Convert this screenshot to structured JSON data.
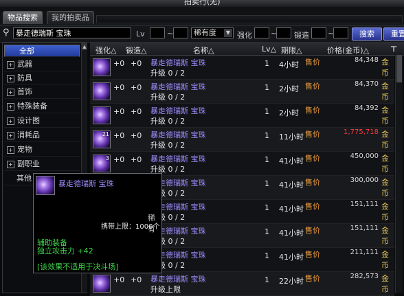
{
  "window": {
    "title": "拍卖行(无)"
  },
  "tabs": [
    {
      "label": "物品搜索",
      "active": true
    },
    {
      "label": "我的拍卖品",
      "active": false
    }
  ],
  "search": {
    "value": "暴走德瑞斯  宝珠",
    "lv_label": "Lv",
    "tilde": "~",
    "rarity_select": "稀有度",
    "enhance_label": "强化",
    "refine_label": "锻造",
    "search_button": "搜索",
    "reset_button": "重置"
  },
  "categories": [
    {
      "label": "全部",
      "selected": true,
      "expandable": false
    },
    {
      "label": "武器",
      "selected": false,
      "expandable": true
    },
    {
      "label": "防具",
      "selected": false,
      "expandable": true
    },
    {
      "label": "首饰",
      "selected": false,
      "expandable": true
    },
    {
      "label": "特殊装备",
      "selected": false,
      "expandable": true
    },
    {
      "label": "设计图",
      "selected": false,
      "expandable": true
    },
    {
      "label": "消耗品",
      "selected": false,
      "expandable": true
    },
    {
      "label": "宠物",
      "selected": false,
      "expandable": true
    },
    {
      "label": "副职业",
      "selected": false,
      "expandable": true
    },
    {
      "label": "其他",
      "selected": false,
      "expandable": false
    }
  ],
  "columns": {
    "enhance": "强化△",
    "refine": "锻造△",
    "name": "名称△",
    "lv": "Lv△",
    "period": "期限△",
    "price": "价格(金币)△"
  },
  "listings": [
    {
      "count": "",
      "enhance": "+0",
      "refine": "+0",
      "name": "暴走德瑞斯  宝珠",
      "upgrade": "升级 0 / 2",
      "lv": "1",
      "time": "4小时",
      "type": "售价",
      "price": "84,348",
      "currency": "金币",
      "red": false
    },
    {
      "count": "",
      "enhance": "+0",
      "refine": "+0",
      "name": "暴走德瑞斯  宝珠",
      "upgrade": "升级 0 / 2",
      "lv": "1",
      "time": "2小时",
      "type": "售价",
      "price": "84,370",
      "currency": "金币",
      "red": false
    },
    {
      "count": "",
      "enhance": "+0",
      "refine": "+0",
      "name": "暴走德瑞斯  宝珠",
      "upgrade": "升级 0 / 2",
      "lv": "1",
      "time": "2小时",
      "type": "售价",
      "price": "84,392",
      "currency": "金币",
      "red": false
    },
    {
      "count": "21",
      "enhance": "+0",
      "refine": "+0",
      "name": "暴走德瑞斯  宝珠",
      "upgrade": "升级 0 / 2",
      "lv": "1",
      "time": "11小时",
      "type": "售价",
      "price": "1,775,718",
      "currency": "金币",
      "red": true
    },
    {
      "count": "3",
      "enhance": "+0",
      "refine": "+0",
      "name": "暴走德瑞斯  宝珠",
      "upgrade": "升级 0 / 2",
      "lv": "1",
      "time": "41小时",
      "type": "售价",
      "price": "450,000",
      "currency": "金币",
      "red": false
    },
    {
      "count": "",
      "enhance": "+0",
      "refine": "+0",
      "name": "暴走德瑞斯  宝珠",
      "upgrade": "升级 0 / 2",
      "lv": "1",
      "time": "41小时",
      "type": "售价",
      "price": "300,000",
      "currency": "金币",
      "red": false
    },
    {
      "count": "",
      "enhance": "+0",
      "refine": "+0",
      "name": "暴走德瑞斯  宝珠",
      "upgrade": "升级 0 / 2",
      "lv": "1",
      "time": "41小时",
      "type": "售价",
      "price": "151,111",
      "currency": "金币",
      "red": false
    },
    {
      "count": "",
      "enhance": "+0",
      "refine": "+0",
      "name": "暴走德瑞斯  宝珠",
      "upgrade": "升级 0 / 2",
      "lv": "1",
      "time": "41小时",
      "type": "售价",
      "price": "151,111",
      "currency": "金币",
      "red": false
    },
    {
      "count": "",
      "enhance": "+0",
      "refine": "+0",
      "name": "暴走德瑞斯  宝珠",
      "upgrade": "升级 0 / 2",
      "lv": "1",
      "time": "41小时",
      "type": "售价",
      "price": "211,111",
      "currency": "金币",
      "red": false
    },
    {
      "count": "",
      "enhance": "+0",
      "refine": "+0",
      "name": "暴走德瑞斯  宝珠",
      "upgrade": "升级上限",
      "lv": "1",
      "time": "22小时",
      "type": "售价",
      "price": "282,573",
      "currency": "金币",
      "red": false
    }
  ],
  "tooltip": {
    "name": "暴走德瑞斯  宝珠",
    "rarity": "稀有",
    "limit": "携带上限：1000个",
    "category": "辅助装备",
    "attack": "独立攻击力 +42",
    "note": "[该效果不适用于决斗场]"
  },
  "colors": {
    "item_name": "#9e8cff",
    "sale_type": "#e89a3c",
    "currency": "#e6c85a",
    "high_price": "#ff3a3a",
    "effect_text": "#3fd64a",
    "selected_category": "#3d5fcf"
  },
  "icons": {
    "search": "search-icon",
    "filter": "filter-icon",
    "expand": "plus-icon",
    "dropdown": "chevron-down-icon"
  }
}
